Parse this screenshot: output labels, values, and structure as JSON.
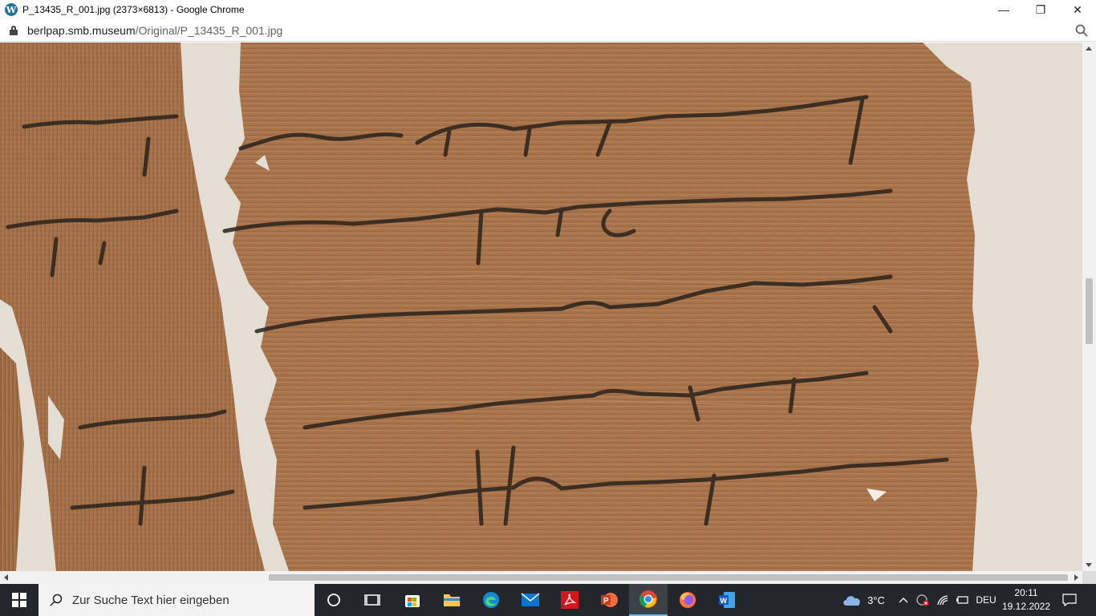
{
  "window": {
    "title": "P_13435_R_001.jpg (2373×6813) - Google Chrome",
    "minimize": "—",
    "restore": "❐",
    "close": "✕"
  },
  "address": {
    "host": "berlpap.smb.museum",
    "path": "/Original/P_13435_R_001.jpg"
  },
  "taskbar": {
    "search_placeholder": "Zur Suche Text hier eingeben",
    "weather_temp": "3°C",
    "language": "DEU",
    "time": "20:11",
    "date": "19.12.2022",
    "apps": [
      "cortana-icon",
      "task-view-icon",
      "microsoft-store-icon",
      "file-explorer-icon",
      "edge-icon",
      "mail-icon",
      "acrobat-icon",
      "powerpoint-icon",
      "chrome-icon",
      "firefox-icon",
      "word-icon"
    ]
  },
  "colors": {
    "papyrus": "#a8734a",
    "papyrus_dark": "#7e5233",
    "ink": "#2b221c",
    "background": "#e3ddd3",
    "taskbar": "#23262a"
  }
}
